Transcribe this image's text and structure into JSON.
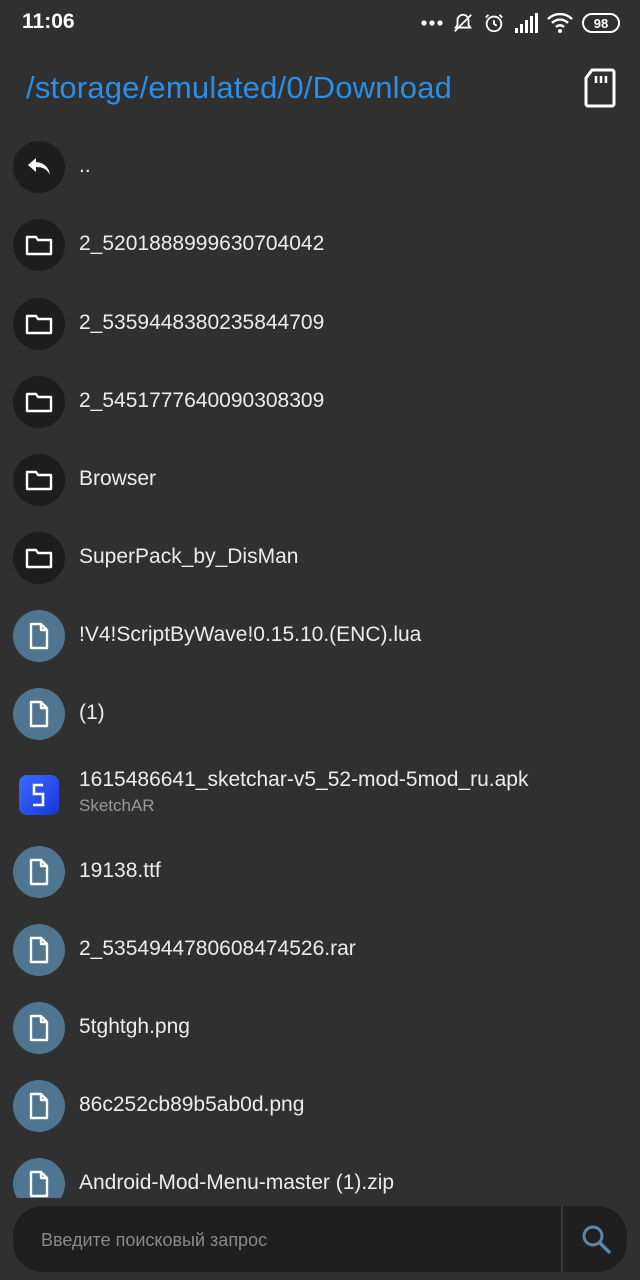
{
  "status_bar": {
    "time": "11:06",
    "battery": "98",
    "icons": [
      "dots-icon",
      "mute-icon",
      "alarm-icon",
      "signal-icon",
      "wifi-icon",
      "battery-icon"
    ]
  },
  "header": {
    "path": "/storage/emulated/0/Download",
    "storage_icon": "sd-card-icon"
  },
  "files": [
    {
      "name": "..",
      "icon": "back-arrow-icon",
      "kind": "parent"
    },
    {
      "name": "2_5201888999630704042",
      "icon": "folder-icon",
      "kind": "folder"
    },
    {
      "name": "2_5359448380235844709",
      "icon": "folder-icon",
      "kind": "folder"
    },
    {
      "name": "2_5451777640090308309",
      "icon": "folder-icon",
      "kind": "folder"
    },
    {
      "name": "Browser",
      "icon": "folder-icon",
      "kind": "folder"
    },
    {
      "name": "SuperPack_by_DisMan",
      "icon": "folder-icon",
      "kind": "folder"
    },
    {
      "name": "!V4!ScriptByWave!0.15.10.(ENC).lua",
      "icon": "file-icon",
      "kind": "file"
    },
    {
      "name": "(1)",
      "icon": "file-icon",
      "kind": "file"
    },
    {
      "name": "1615486641_sketchar-v5_52-mod-5mod_ru.apk",
      "subtitle": "SketchAR",
      "icon": "apk-app-icon",
      "kind": "apk"
    },
    {
      "name": "19138.ttf",
      "icon": "file-icon",
      "kind": "file"
    },
    {
      "name": "2_5354944780608474526.rar",
      "icon": "file-icon",
      "kind": "file"
    },
    {
      "name": "5tghtgh.png",
      "icon": "file-icon",
      "kind": "file"
    },
    {
      "name": "86c252cb89b5ab0d.png",
      "icon": "file-icon",
      "kind": "file"
    },
    {
      "name": "Android-Mod-Menu-master (1).zip",
      "icon": "file-icon",
      "kind": "file"
    }
  ],
  "search": {
    "placeholder": "Введите поисковый запрос",
    "value": ""
  },
  "colors": {
    "background": "#303030",
    "accent": "#2b8fe8",
    "folder_circle": "#1d1d1d",
    "file_circle": "#4f7590"
  }
}
